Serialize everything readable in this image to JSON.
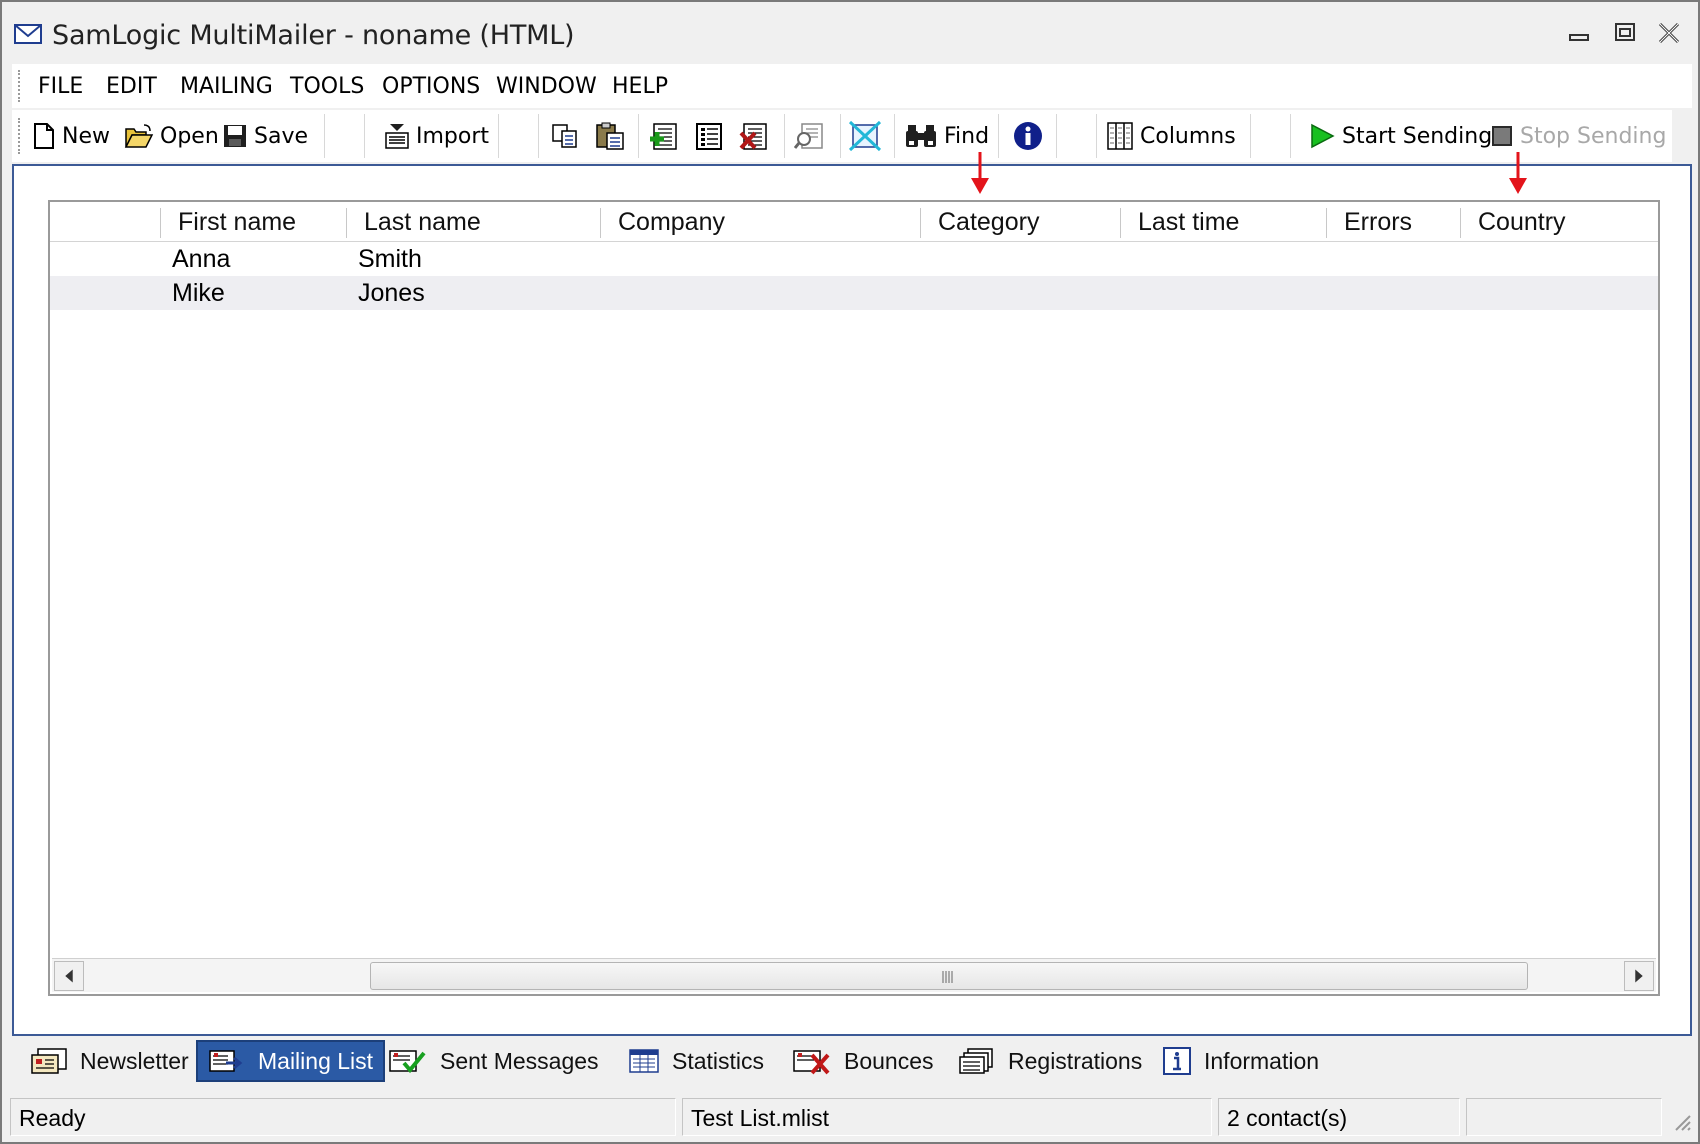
{
  "window": {
    "title": "SamLogic MultiMailer - noname  (HTML)",
    "icon": "envelope-icon"
  },
  "menu": {
    "items": [
      "FILE",
      "EDIT",
      "MAILING",
      "TOOLS",
      "OPTIONS",
      "WINDOW",
      "HELP"
    ]
  },
  "toolbar": {
    "new_label": "New",
    "open_label": "Open",
    "save_label": "Save",
    "import_label": "Import",
    "find_label": "Find",
    "columns_label": "Columns",
    "start_label": "Start Sending",
    "stop_label": "Stop Sending",
    "icons": [
      "new-document-icon",
      "open-folder-icon",
      "save-disk-icon",
      "import-icon",
      "copy-icon",
      "paste-icon",
      "add-contact-icon",
      "edit-contact-icon",
      "delete-contact-icon",
      "preview-icon",
      "clear-icon",
      "binoculars-icon",
      "info-icon",
      "columns-icon",
      "play-icon",
      "stop-icon"
    ]
  },
  "grid": {
    "columns": [
      "",
      "First name",
      "Last name",
      "Company",
      "Category",
      "Last time",
      "Errors",
      "Country"
    ],
    "rows": [
      {
        "first": "Anna",
        "last": "Smith",
        "company": "",
        "category": "",
        "last_time": "",
        "errors": "",
        "country": ""
      },
      {
        "first": "Mike",
        "last": "Jones",
        "company": "",
        "category": "",
        "last_time": "",
        "errors": "",
        "country": ""
      }
    ]
  },
  "tabs": [
    {
      "label": "Newsletter",
      "icon": "newsletter-icon",
      "active": false
    },
    {
      "label": "Mailing List",
      "icon": "mailing-list-icon",
      "active": true
    },
    {
      "label": "Sent Messages",
      "icon": "sent-messages-icon",
      "active": false
    },
    {
      "label": "Statistics",
      "icon": "statistics-icon",
      "active": false
    },
    {
      "label": "Bounces",
      "icon": "bounces-icon",
      "active": false
    },
    {
      "label": "Registrations",
      "icon": "registrations-icon",
      "active": false
    },
    {
      "label": "Information",
      "icon": "information-icon",
      "active": false
    }
  ],
  "status": {
    "state": "Ready",
    "file": "Test List.mlist",
    "count": "2 contact(s)",
    "extra": ""
  },
  "colors": {
    "accent": "#2b5aa5",
    "panel_border": "#3c5a96",
    "annotation_arrow": "#e3141b",
    "row_alt": "#eeeef2"
  }
}
